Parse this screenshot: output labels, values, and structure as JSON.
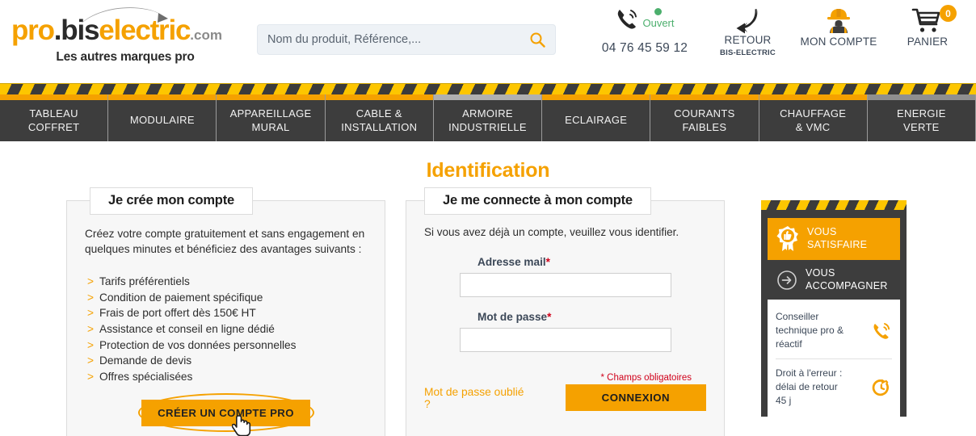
{
  "header": {
    "logo": {
      "part1": "pro",
      "part2": ".bis",
      "part3": "electric",
      "tld": ".com",
      "tagline": "Les autres marques pro"
    },
    "search": {
      "placeholder": "Nom du produit, Référence,...",
      "value": "",
      "icon": "search-icon"
    },
    "phone": {
      "status": "Ouvert",
      "number": "04 76 45 59 12",
      "status_color": "#4caf6d",
      "icon": "phone-ringing-icon"
    },
    "retour": {
      "label": "RETOUR",
      "sub": "BIS-ELECTRIC",
      "icon": "return-arrow-icon"
    },
    "account": {
      "label": "MON COMPTE",
      "icon": "worker-helmet-icon"
    },
    "cart": {
      "label": "PANIER",
      "count": "0",
      "icon": "shopping-cart-icon"
    }
  },
  "nav": {
    "items": [
      {
        "label": "TABLEAU\nCOFFRET",
        "line1": "TABLEAU",
        "line2": "COFFRET",
        "accent": "#F5A100"
      },
      {
        "label": "MODULAIRE",
        "line1": "MODULAIRE",
        "line2": "",
        "accent": "#F5A100"
      },
      {
        "label": "APPAREILLAGE MURAL",
        "line1": "APPAREILLAGE",
        "line2": "MURAL",
        "accent": "#F5A100"
      },
      {
        "label": "CABLE & INSTALLATION",
        "line1": "CABLE &",
        "line2": "INSTALLATION",
        "accent": "#F5A100"
      },
      {
        "label": "ARMOIRE INDUSTRIELLE",
        "line1": "ARMOIRE",
        "line2": "INDUSTRIELLE",
        "accent": "#b0b0b0"
      },
      {
        "label": "ECLAIRAGE",
        "line1": "ECLAIRAGE",
        "line2": "",
        "accent": "#F5A100"
      },
      {
        "label": "COURANTS FAIBLES",
        "line1": "COURANTS",
        "line2": "FAIBLES",
        "accent": "#F5A100"
      },
      {
        "label": "CHAUFFAGE & VMC",
        "line1": "CHAUFFAGE",
        "line2": "& VMC",
        "accent": "#F5A100"
      },
      {
        "label": "ENERGIE VERTE",
        "line1": "ENERGIE",
        "line2": "VERTE",
        "accent": "#8f8f8f"
      }
    ]
  },
  "main": {
    "page_title": "Identification",
    "create_panel": {
      "title": "Je crée mon compte",
      "intro": "Créez votre compte gratuitement et sans engagement en quelques minutes et bénéficiez des avantages suivants :",
      "benefits": [
        "Tarifs préférentiels",
        "Condition de paiement spécifique",
        "Frais de port offert dès 150€ HT",
        "Assistance et conseil en ligne dédié",
        "Protection de vos données personnelles",
        "Demande de devis",
        "Offres spécialisées"
      ],
      "chevron": ">",
      "cta_label": "CRÉER UN COMPTE PRO"
    },
    "login_panel": {
      "title": "Je me connecte à mon compte",
      "intro": "Si vous avez déjà un compte, veuillez vous identifier.",
      "email_label": "Adresse mail",
      "email_value": "",
      "password_label": "Mot de passe",
      "password_value": "",
      "required_marker": "*",
      "required_note": "* Champs obligatoires",
      "forgot_label": "Mot de passe oublié ?",
      "submit_label": "CONNEXION"
    }
  },
  "sidebar": {
    "tab_satisfaire": {
      "line1": "VOUS",
      "line2": "SATISFAIRE",
      "icon": "ribbon-thumbs-up-icon"
    },
    "tab_accompagner": {
      "line1": "VOUS",
      "line2": "ACCOMPAGNER",
      "icon": "arrow-circle-right-icon"
    },
    "rows": [
      {
        "text": "Conseiller technique pro & réactif",
        "icon": "phone-ringing-icon"
      },
      {
        "text": "Droit à l'erreur : délai de retour 45 j",
        "icon": "stopwatch-return-icon"
      }
    ]
  },
  "colors": {
    "brand_orange": "#F5A100",
    "hazard_yellow": "#FDC600",
    "dark": "#3d3d3d",
    "required_red": "#d0021b",
    "open_green": "#4caf6d"
  }
}
